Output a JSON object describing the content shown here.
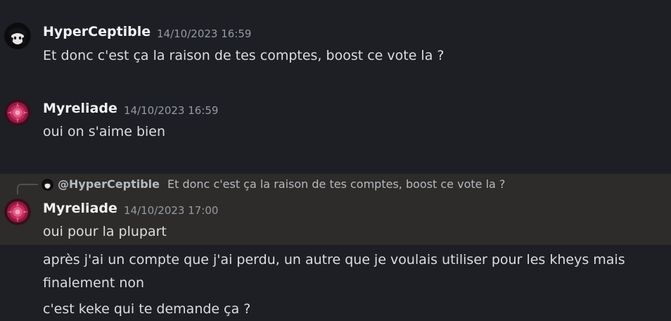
{
  "messages": [
    {
      "author": "HyperCeptible",
      "timestamp": "14/10/2023 16:59",
      "lines": [
        "Et donc c'est ça la raison de tes comptes, boost ce vote la ?"
      ]
    },
    {
      "author": "Myreliade",
      "timestamp": "14/10/2023 16:59",
      "lines": [
        "oui on s'aime bien"
      ]
    },
    {
      "reply_to": {
        "mention": "@HyperCeptible",
        "text": "Et donc c'est ça la raison de tes comptes, boost ce vote la ?"
      },
      "author": "Myreliade",
      "timestamp": "14/10/2023 17:00",
      "lines": [
        "oui pour la plupart"
      ]
    }
  ],
  "followups": [
    {
      "lines": [
        "après j'ai un compte que j'ai perdu, un autre que je voulais utiliser pour les kheys mais",
        "finalement non"
      ]
    },
    {
      "lines": [
        "c'est keke qui te demande ça ?"
      ]
    }
  ],
  "colors": {
    "background": "#1e1f24",
    "highlight": "#2e2c2a",
    "author": "#f2f3f5",
    "text": "#dbdee1",
    "timestamp": "#949ba4"
  }
}
